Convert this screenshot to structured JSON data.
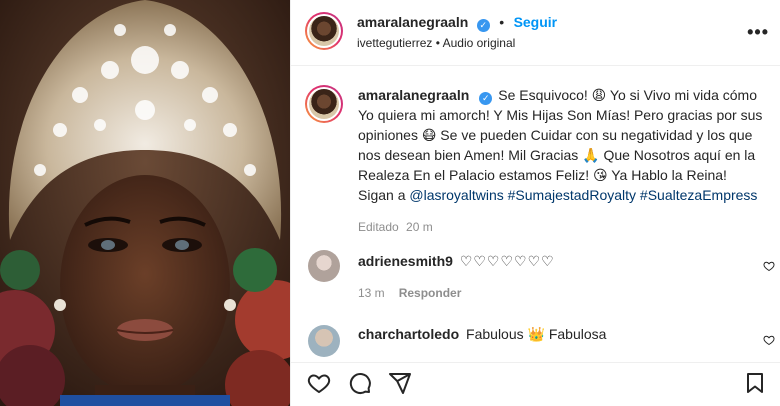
{
  "post": {
    "author": "amaralanegraaln",
    "follow_label": "Seguir",
    "dot": "•",
    "audio_user": "ivettegutierrez",
    "audio_sep": " • ",
    "audio_label": "Audio original",
    "more_label": "•••"
  },
  "caption": {
    "username": "amaralanegraaln",
    "text_1": "Se Esquivoco! 😩 Yo si Vivo mi vida cómo Yo quiera mi amorch! Y Mis Hijas Son Mías! Pero gracias por sus opiniones 😷 Se ve pueden Cuidar con su negatividad y los que nos desean bien Amen! Mil Gracias 🙏 Que Nosotros aquí en la Realeza En el Palacio estamos Feliz! 😘 Ya Hablo la Reina! Sigan a ",
    "mention": "@lasroyaltwins",
    "hashtag_1": "#SumajestadRoyalty",
    "hashtag_2": "#SualtezaEmpress",
    "edited": "Editado",
    "time": "20 m"
  },
  "comments": [
    {
      "username": "adrienesmith9",
      "text": "♡♡♡♡♡♡♡",
      "time": "13 m",
      "reply": "Responder"
    },
    {
      "username": "charchartoledo",
      "text": "Fabulous 👑 Fabulosa"
    }
  ],
  "icons": {
    "like": "heart-icon",
    "comment": "comment-icon",
    "share": "share-icon",
    "save": "bookmark-icon"
  },
  "colors": {
    "accent": "#0095f6",
    "verified": "#3897f0",
    "link": "#00376b",
    "muted": "#8e8e8e"
  }
}
